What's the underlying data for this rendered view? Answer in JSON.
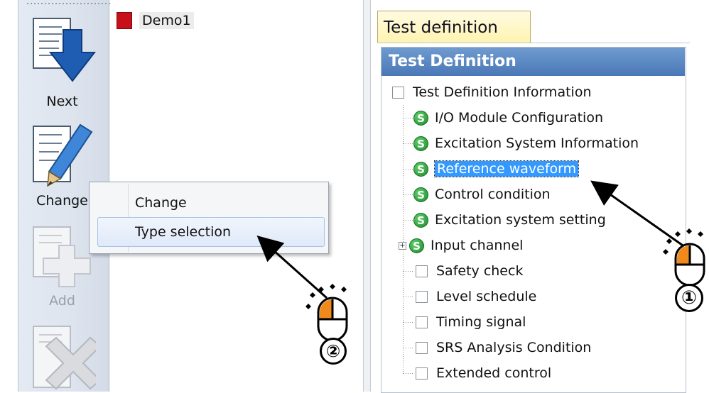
{
  "toolbar": {
    "next_label": "Next",
    "change_label": "Change",
    "add_label": "Add"
  },
  "left_tree": {
    "root_label": "Demo1"
  },
  "context_menu": {
    "items": [
      {
        "label": "Change"
      },
      {
        "label": "Type selection",
        "highlighted": true
      }
    ]
  },
  "right_pane": {
    "tab_label": "Test definition",
    "panel_title": "Test Definition",
    "tree": {
      "root": "Test Definition Information",
      "items": [
        {
          "label": "I/O Module Configuration",
          "icon": "s-badge-icon"
        },
        {
          "label": "Excitation System Information",
          "icon": "s-badge-icon"
        },
        {
          "label": "Reference waveform",
          "icon": "s-badge-icon",
          "selected": true
        },
        {
          "label": "Control condition",
          "icon": "s-badge-icon"
        },
        {
          "label": "Excitation system setting",
          "icon": "s-badge-icon"
        },
        {
          "label": "Input channel",
          "icon": "s-badge-icon",
          "expandable": true
        },
        {
          "label": "Safety check",
          "icon": "checkbox"
        },
        {
          "label": "Level schedule",
          "icon": "checkbox"
        },
        {
          "label": "Timing signal",
          "icon": "checkbox"
        },
        {
          "label": "SRS Analysis Condition",
          "icon": "checkbox"
        },
        {
          "label": "Extended control",
          "icon": "checkbox"
        }
      ]
    }
  },
  "callouts": {
    "step1": "①",
    "step2": "②",
    "s_badge": "S"
  },
  "colors": {
    "accent_blue": "#3399ff",
    "mouse_button": "#f08a1c",
    "tab_yellow": "#fff3b0",
    "header_blue": "#4a78b6",
    "s_badge_green": "#1e8a2c"
  }
}
